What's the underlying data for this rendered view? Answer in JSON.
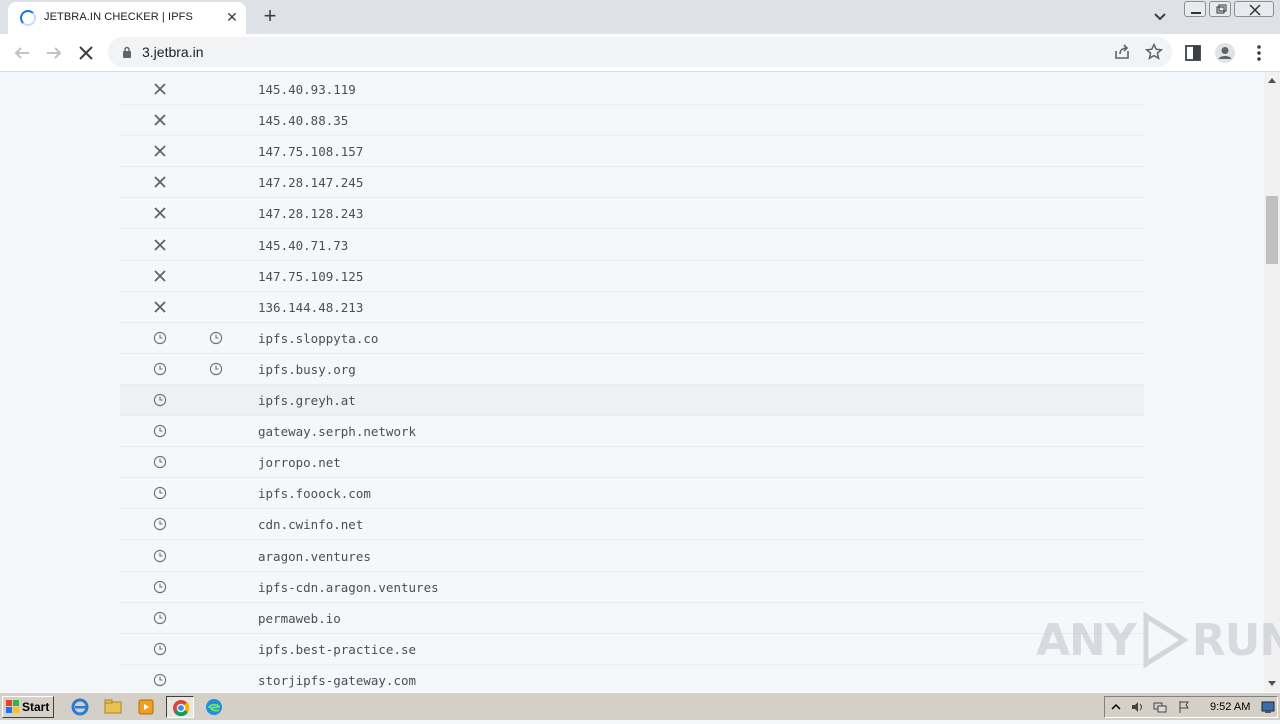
{
  "browser": {
    "tab_title": "JETBRA.IN CHECKER | IPFS",
    "url": "3.jetbra.in"
  },
  "rows": [
    {
      "status": "x-icon",
      "status2": "",
      "host": "145.40.93.119"
    },
    {
      "status": "x-icon",
      "status2": "",
      "host": "145.40.88.35"
    },
    {
      "status": "x-icon",
      "status2": "",
      "host": "147.75.108.157"
    },
    {
      "status": "x-icon",
      "status2": "",
      "host": "147.28.147.245"
    },
    {
      "status": "x-icon",
      "status2": "",
      "host": "147.28.128.243"
    },
    {
      "status": "x-icon",
      "status2": "",
      "host": "145.40.71.73"
    },
    {
      "status": "x-icon",
      "status2": "",
      "host": "147.75.109.125"
    },
    {
      "status": "x-icon",
      "status2": "",
      "host": "136.144.48.213"
    },
    {
      "status": "clock-icon",
      "status2": "clock-icon",
      "host": "ipfs.sloppyta.co"
    },
    {
      "status": "clock-icon",
      "status2": "clock-icon",
      "host": "ipfs.busy.org"
    },
    {
      "status": "clock-icon",
      "status2": "",
      "host": "ipfs.greyh.at",
      "highlight": true
    },
    {
      "status": "clock-icon",
      "status2": "",
      "host": "gateway.serph.network"
    },
    {
      "status": "clock-icon",
      "status2": "",
      "host": "jorropo.net"
    },
    {
      "status": "clock-icon",
      "status2": "",
      "host": "ipfs.fooock.com"
    },
    {
      "status": "clock-icon",
      "status2": "",
      "host": "cdn.cwinfo.net"
    },
    {
      "status": "clock-icon",
      "status2": "",
      "host": "aragon.ventures"
    },
    {
      "status": "clock-icon",
      "status2": "",
      "host": "ipfs-cdn.aragon.ventures"
    },
    {
      "status": "clock-icon",
      "status2": "",
      "host": "permaweb.io"
    },
    {
      "status": "clock-icon",
      "status2": "",
      "host": "ipfs.best-practice.se"
    },
    {
      "status": "clock-icon",
      "status2": "",
      "host": "storjipfs-gateway.com"
    }
  ],
  "watermark": {
    "left": "ANY",
    "right": "RUN"
  },
  "taskbar": {
    "start_label": "Start",
    "clock": "9:52 AM"
  },
  "colors": {
    "accent": "#1a73e8",
    "page_bg": "#f5f8fb",
    "icon_gray": "#5f6368"
  }
}
